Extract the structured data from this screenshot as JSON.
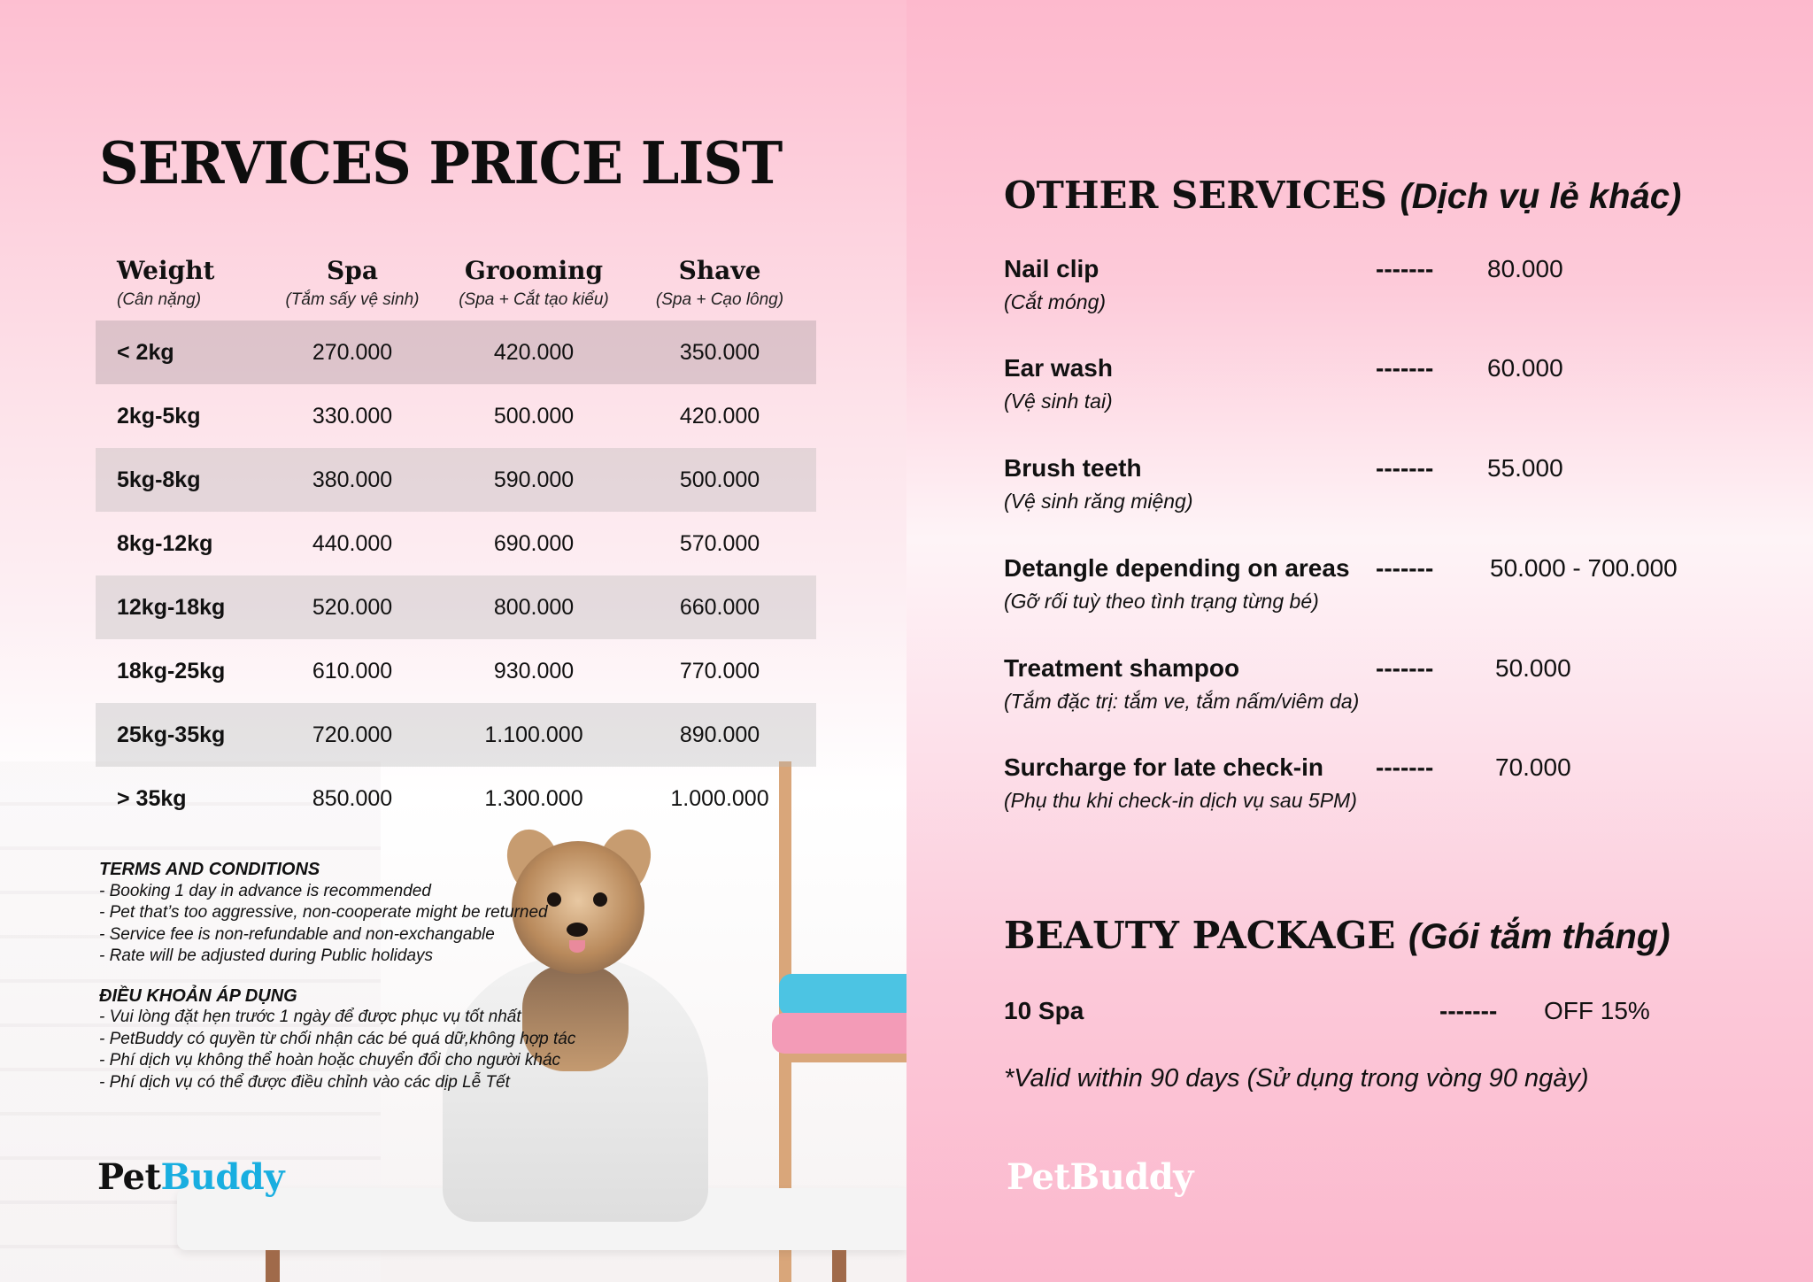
{
  "left": {
    "title": "SERVICES PRICE LIST",
    "columns": [
      {
        "label": "Weight",
        "sub": "(Cân nặng)"
      },
      {
        "label": "Spa",
        "sub": "(Tắm sấy vệ sinh)"
      },
      {
        "label": "Grooming",
        "sub": "(Spa + Cắt tạo kiểu)"
      },
      {
        "label": "Shave",
        "sub": "(Spa + Cạo lông)"
      }
    ],
    "rows": [
      [
        "< 2kg",
        "270.000",
        "420.000",
        "350.000"
      ],
      [
        "2kg-5kg",
        "330.000",
        "500.000",
        "420.000"
      ],
      [
        "5kg-8kg",
        "380.000",
        "590.000",
        "500.000"
      ],
      [
        "8kg-12kg",
        "440.000",
        "690.000",
        "570.000"
      ],
      [
        "12kg-18kg",
        "520.000",
        "800.000",
        "660.000"
      ],
      [
        "18kg-25kg",
        "610.000",
        "930.000",
        "770.000"
      ],
      [
        "25kg-35kg",
        "720.000",
        "1.100.000",
        "890.000"
      ],
      [
        "> 35kg",
        "850.000",
        "1.300.000",
        "1.000.000"
      ]
    ],
    "terms_en_title": "TERMS AND CONDITIONS",
    "terms_en": [
      "- Booking 1 day in advance is recommended",
      "- Pet that’s too aggressive, non-cooperate might be returned",
      "- Service fee is non-refundable and non-exchangable",
      "- Rate will be adjusted during Public holidays"
    ],
    "terms_vi_title": "ĐIỀU KHOẢN ÁP DỤNG",
    "terms_vi": [
      "- Vui lòng đặt hẹn trước 1 ngày để được phục vụ tốt nhất",
      "- PetBuddy có quyền từ chối nhận các bé quá dữ,không hợp tác",
      "- Phí dịch vụ không thể hoàn hoặc chuyển đổi cho người khác",
      "- Phí dịch vụ có thể được điều chỉnh vào các dịp Lễ Tết"
    ],
    "logo_pet": "Pet",
    "logo_buddy": "Buddy"
  },
  "right": {
    "other_title": "OTHER SERVICES",
    "other_title_sub": "(Dịch vụ lẻ khác)",
    "services": [
      {
        "name": "Nail clip",
        "sub": "(Cắt móng)",
        "dash": "-------",
        "price": "80.000"
      },
      {
        "name": "Ear wash",
        "sub": "(Vệ sinh tai)",
        "dash": "-------",
        "price": "60.000"
      },
      {
        "name": "Brush teeth",
        "sub": "(Vệ sinh răng miệng)",
        "dash": "-------",
        "price": "55.000"
      },
      {
        "name": "Detangle depending on areas",
        "sub": "(Gỡ rối tuỳ theo tình trạng từng bé)",
        "dash": "-------",
        "price": "50.000 - 700.000"
      },
      {
        "name": "Treatment shampoo",
        "sub": "(Tắm đặc trị: tắm ve, tắm nấm/viêm da)",
        "dash": "-------",
        "price": "50.000"
      },
      {
        "name": "Surcharge for late check-in",
        "sub": "(Phụ thu khi check-in dịch vụ sau 5PM)",
        "dash": "-------",
        "price": "70.000"
      }
    ],
    "beauty_title": "BEAUTY PACKAGE",
    "beauty_title_sub": "(Gói tắm tháng)",
    "package_name": "10 Spa",
    "package_dash": "-------",
    "package_offer": "OFF 15%",
    "package_note": "*Valid within 90 days (Sử dụng trong vòng 90 ngày)",
    "logo": "PetBuddy"
  },
  "colors": {
    "brand_blue": "#19aee0",
    "pink": "#fdb9cd"
  }
}
